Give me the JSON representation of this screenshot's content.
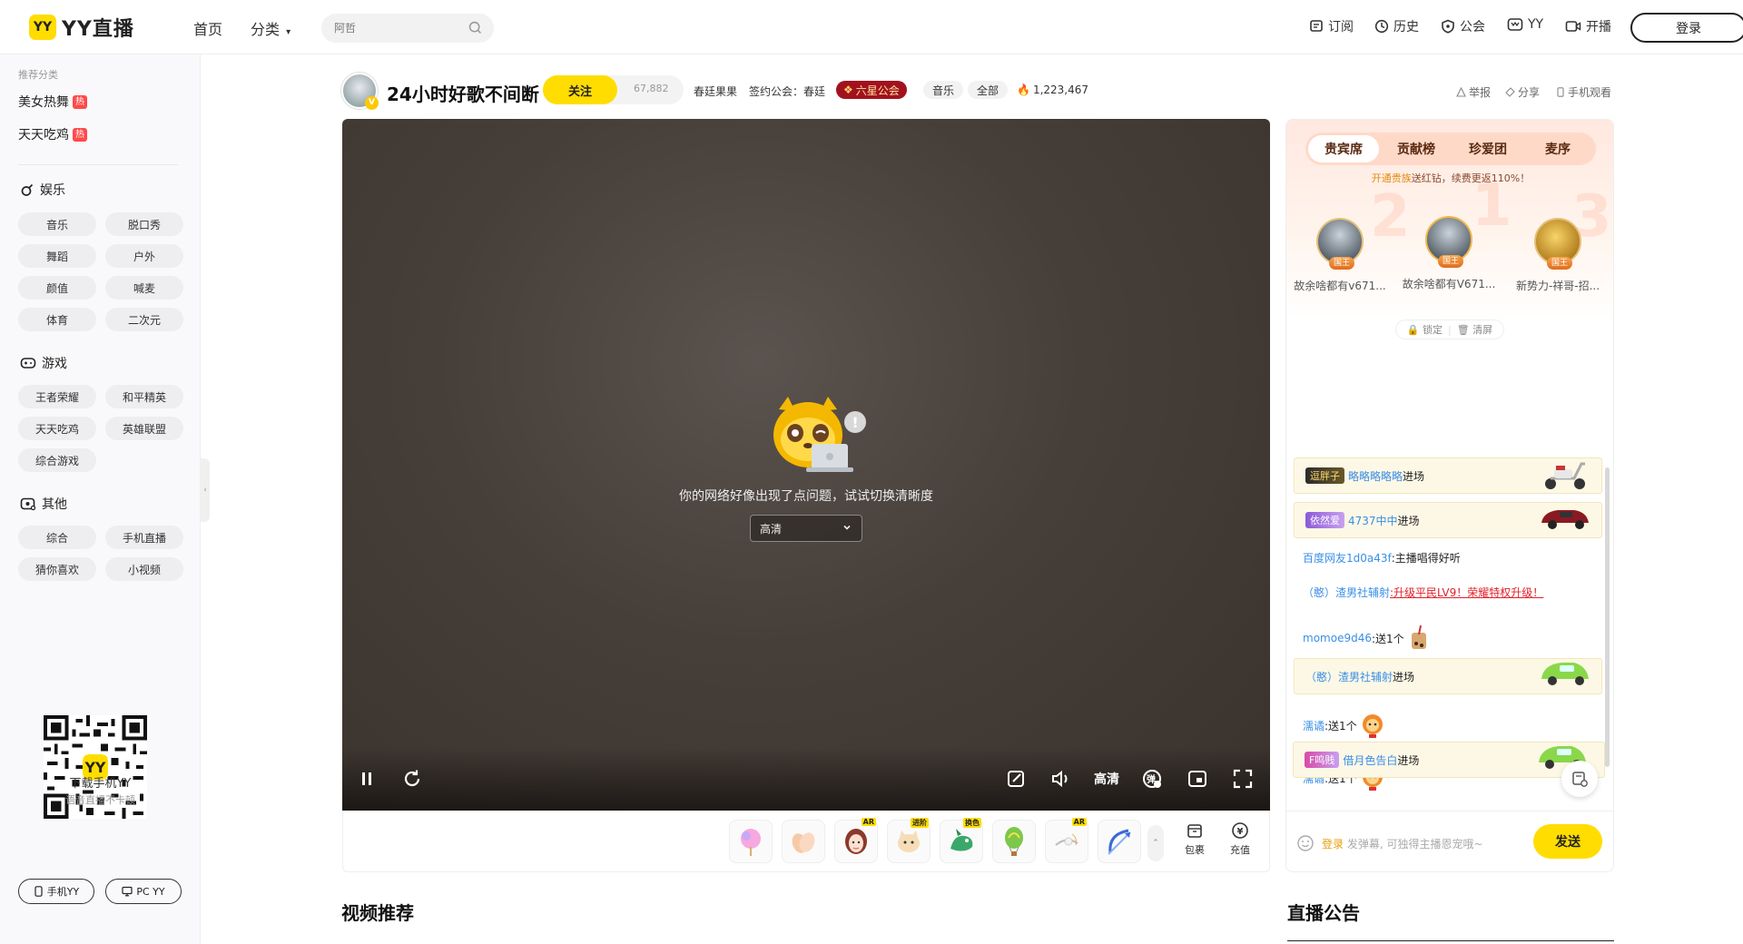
{
  "header": {
    "logo_text": "YY直播",
    "logo_badge": "YY",
    "nav_home": "首页",
    "nav_category": "分类",
    "search_placeholder": "阿哲",
    "subscribe": "订阅",
    "history": "历史",
    "guild": "公会",
    "yy": "YY",
    "broadcast": "开播",
    "login": "登录"
  },
  "sidebar": {
    "recommend_header": "推荐分类",
    "recommend": [
      {
        "label": "美女热舞",
        "badge": "热"
      },
      {
        "label": "天天吃鸡",
        "badge": "热"
      }
    ],
    "sections": [
      {
        "title": "娱乐",
        "items": [
          "音乐",
          "脱口秀",
          "舞蹈",
          "户外",
          "颜值",
          "喊麦",
          "体育",
          "二次元"
        ]
      },
      {
        "title": "游戏",
        "items": [
          "王者荣耀",
          "和平精英",
          "天天吃鸡",
          "英雄联盟",
          "综合游戏"
        ]
      },
      {
        "title": "其他",
        "items": [
          "综合",
          "手机直播",
          "猜你喜欢",
          "小视频"
        ]
      }
    ],
    "qr_title": "下载手机YY",
    "qr_subtitle": "语音直播不卡顿",
    "mobile_yy": "手机YY",
    "pc_yy": "PC YY"
  },
  "room": {
    "title": "24小时好歌不间断",
    "follow_label": "关注",
    "follower_count": "67,882",
    "anchor_name": "春廷果果",
    "guild_prefix": "签约公会：春廷",
    "guild_badge": "六星公会",
    "tag_music": "音乐",
    "tag_all": "全部",
    "heat": "1,223,467",
    "report": "举报",
    "share": "分享",
    "mobile_watch": "手机观看"
  },
  "player": {
    "error_message": "你的网络好像出现了点问题，试试切换清晰度",
    "quality_select": "高清",
    "quality_label": "高清"
  },
  "gifts": {
    "items": [
      {
        "icon": "cotton-candy",
        "tag": ""
      },
      {
        "icon": "clap-hands",
        "tag": ""
      },
      {
        "icon": "girl-face",
        "tag": "AR"
      },
      {
        "icon": "cat",
        "tag": "进阶"
      },
      {
        "icon": "dragon",
        "tag": "换色"
      },
      {
        "icon": "hot-air-balloon",
        "tag": ""
      },
      {
        "icon": "cupid",
        "tag": "AR"
      },
      {
        "icon": "bow-arrow",
        "tag": ""
      }
    ],
    "backpack": "包裹",
    "recharge": "充值"
  },
  "side_panel": {
    "tabs": [
      "贵宾席",
      "贡献榜",
      "珍爱团",
      "麦序"
    ],
    "promo_link": "开通贵族",
    "promo_text": "送红钻，续费更返110%！",
    "top3": [
      {
        "rank": "2",
        "name": "故余啥都有v671...",
        "title": "国王"
      },
      {
        "rank": "1",
        "name": "故余啥都有V671...",
        "title": "国王"
      },
      {
        "rank": "3",
        "name": "新势力-祥哥-招...",
        "title": "国王"
      }
    ],
    "lock": "锁定",
    "clear": "清屏"
  },
  "chat": {
    "messages": [
      {
        "type": "enter",
        "medal": "逗胖子",
        "user": "略略略略略",
        "text": "进场"
      },
      {
        "type": "enter",
        "medal": "依然爱",
        "user": "4737中中",
        "text": "进场"
      },
      {
        "type": "msg",
        "user": "百度网友1d0a43f",
        "text": ":主播唱得好听"
      },
      {
        "type": "upgrade",
        "user": "（憨）渣男社辅射",
        "text": ":升级平民LV9！荣耀特权升级！"
      },
      {
        "type": "gift",
        "user": "momoe9d46",
        "text": ":送1个"
      },
      {
        "type": "enter",
        "medal": "",
        "user": "（憨）渣男社辅射",
        "text": "进场"
      },
      {
        "type": "gift",
        "user": "濡谲",
        "text": ":送1个"
      },
      {
        "type": "gift",
        "user": "濡谲",
        "text": ":送1个"
      },
      {
        "type": "enter",
        "medal": "F鸣贱",
        "user": "借月色告白",
        "text": "进场"
      }
    ],
    "input_login": "登录",
    "input_placeholder": "发弹幕, 可独得主播恩宠哦~",
    "send": "发送"
  },
  "sections": {
    "video_recommend": "视频推荐",
    "announcement": "直播公告"
  },
  "colors": {
    "brand_yellow": "#ffdd00",
    "guild_red": "#a2121e",
    "link_blue": "#3a8ee6"
  }
}
